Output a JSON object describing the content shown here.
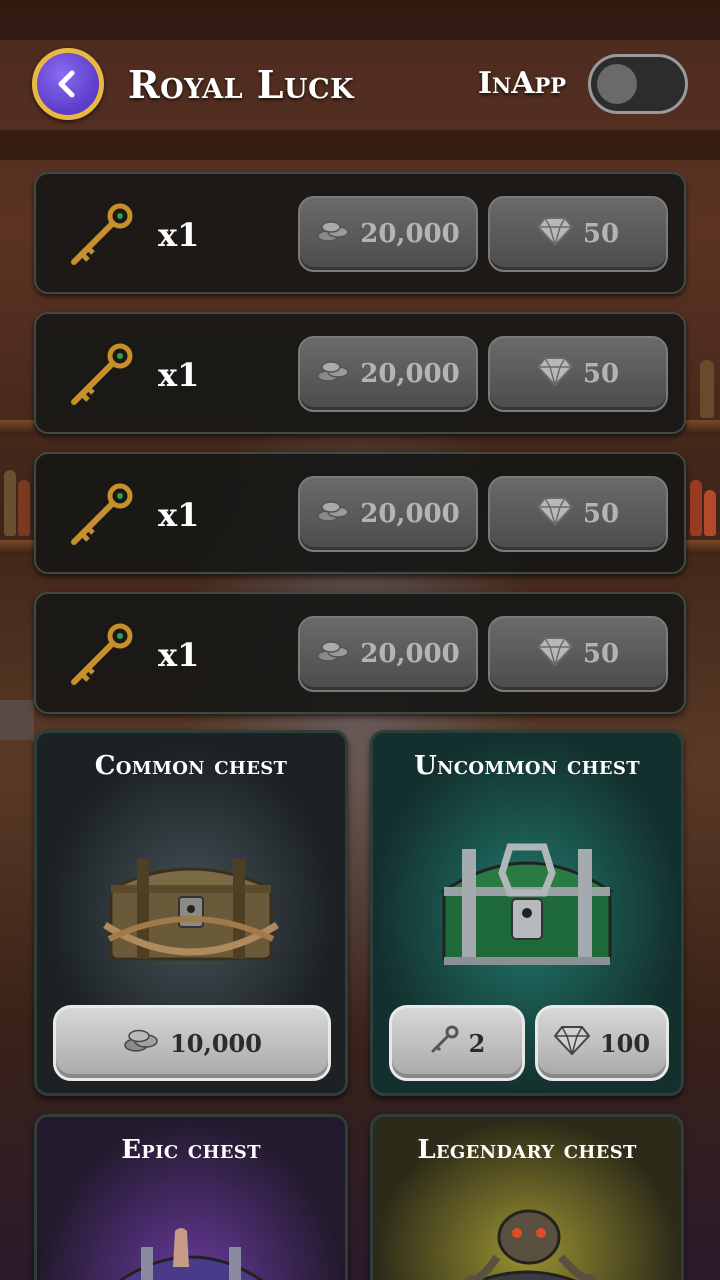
{
  "header": {
    "title": "Royal Luck",
    "inapp_label": "InApp",
    "inapp_enabled": false
  },
  "key_offers": [
    {
      "qty": "x1",
      "coins": "20,000",
      "gems": "50"
    },
    {
      "qty": "x1",
      "coins": "20,000",
      "gems": "50"
    },
    {
      "qty": "x1",
      "coins": "20,000",
      "gems": "50"
    },
    {
      "qty": "x1",
      "coins": "20,000",
      "gems": "50"
    }
  ],
  "chests": {
    "common": {
      "title": "Common chest",
      "coins": "10,000"
    },
    "uncommon": {
      "title": "Uncommon chest",
      "keys": "2",
      "gems": "100"
    },
    "epic": {
      "title": "Epic chest"
    },
    "legendary": {
      "title": "Legendary chest"
    }
  },
  "colors": {
    "back_button": "#6a4ad8",
    "back_border": "#e8b840",
    "uncommon_glow": "#1f8a7a",
    "epic_glow": "#6a3aa8",
    "legendary_glow": "#a8a028"
  }
}
